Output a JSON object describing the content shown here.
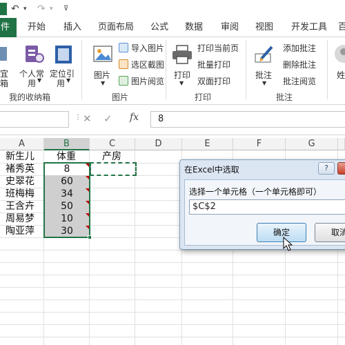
{
  "qat": {
    "undo_icon": "undo-icon",
    "redo_icon": "redo-icon"
  },
  "tabs": [
    "件",
    "开始",
    "插入",
    "页面布局",
    "公式",
    "数据",
    "审阅",
    "视图",
    "开发工具"
  ],
  "ribbon": {
    "left_partial": [
      "宜",
      "箱"
    ],
    "group1": {
      "btn_personal": "个人常",
      "btn_personal_2": "用",
      "btn_locate": "定位引",
      "btn_locate_2": "用",
      "label": "我的收纳箱"
    },
    "group2": {
      "btn_picture": "图片",
      "items": [
        "导入图片",
        "选区截图",
        "图片阅览"
      ],
      "label": "图片"
    },
    "group3": {
      "btn_print": "打印",
      "items": [
        "打印当前页",
        "批量打印",
        "双面打印"
      ],
      "label": "打印"
    },
    "group4": {
      "btn_comment": "批注",
      "items": [
        "添加批注",
        "删除批注",
        "批注阅览"
      ],
      "label": "批注"
    },
    "right_partial": "姓"
  },
  "formula_bar": {
    "value": "8"
  },
  "grid": {
    "columns": [
      "A",
      "B",
      "C",
      "D",
      "E",
      "F",
      "G"
    ],
    "header_row": {
      "a": "新生儿",
      "b": "体重",
      "c": "产房"
    },
    "names": [
      "褚秀英",
      "史翠花",
      "班梅梅",
      "王含卉",
      "周易梦",
      "陶亚萍"
    ],
    "weights": [
      "8",
      "60",
      "34",
      "50",
      "10",
      "30"
    ]
  },
  "dialog": {
    "title": "在Excel中选取",
    "prompt": "选择一个单元格（一个单元格即可）",
    "input_value": "$C$2",
    "ok_label": "确定",
    "cancel_label": "取消"
  },
  "colors": {
    "excel_green": "#217346",
    "selected_fill": "#cfcfcf",
    "dialog_bg": "#dce6f3"
  }
}
